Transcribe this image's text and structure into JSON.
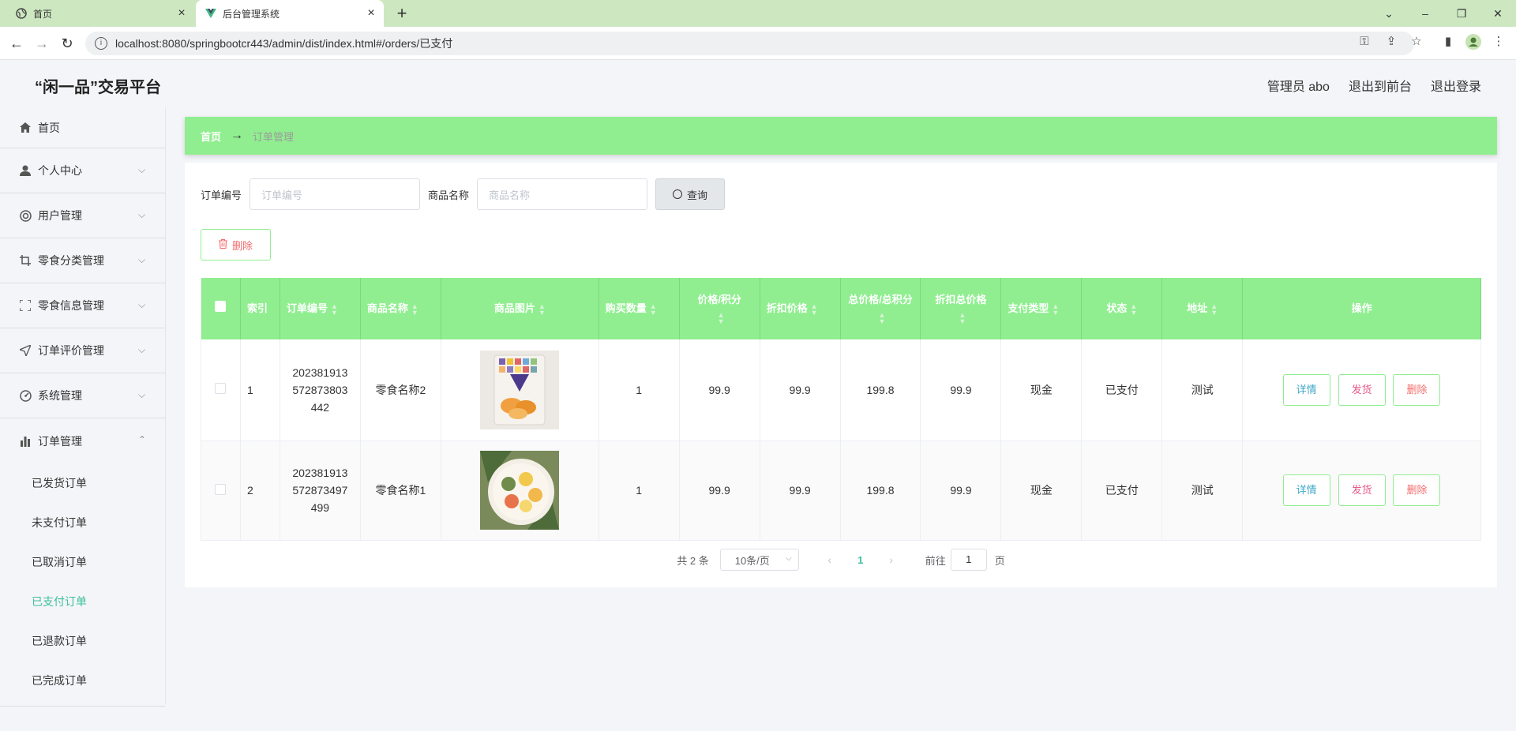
{
  "browser": {
    "tabs": [
      {
        "label": "首页"
      },
      {
        "label": "后台管理系统"
      }
    ],
    "url": "localhost:8080/springbootcr443/admin/dist/index.html#/orders/已支付"
  },
  "header": {
    "logo": "“闲一品”交易平台",
    "user": "管理员 abo",
    "to_front": "退出到前台",
    "logout": "退出登录"
  },
  "sidebar": {
    "items": [
      {
        "label": "首页",
        "icon": "home-icon"
      },
      {
        "label": "个人中心",
        "icon": "user-icon"
      },
      {
        "label": "用户管理",
        "icon": "users-icon"
      },
      {
        "label": "零食分类管理",
        "icon": "crop-icon"
      },
      {
        "label": "零食信息管理",
        "icon": "frame-icon"
      },
      {
        "label": "订单评价管理",
        "icon": "send-icon"
      },
      {
        "label": "系统管理",
        "icon": "gauge-icon"
      },
      {
        "label": "订单管理",
        "icon": "bar-chart-icon"
      }
    ],
    "sub_items": [
      "已发货订单",
      "未支付订单",
      "已取消订单",
      "已支付订单",
      "已退款订单",
      "已完成订单"
    ],
    "active_sub": "已支付订单",
    "active_color": "#3cbfa0"
  },
  "breadcrumb": {
    "home": "首页",
    "current": "订单管理"
  },
  "search": {
    "order_no_label": "订单编号",
    "order_no_placeholder": "订单编号",
    "goods_label": "商品名称",
    "goods_placeholder": "商品名称",
    "query_label": "查询"
  },
  "toolbar": {
    "delete_label": "删除"
  },
  "table": {
    "columns": [
      "索引",
      "订单编号",
      "商品名称",
      "商品图片",
      "购买数量",
      "价格/积分",
      "折扣价格",
      "总价格/总积分",
      "折扣总价格",
      "支付类型",
      "状态",
      "地址",
      "操作"
    ],
    "rows": [
      {
        "index": "1",
        "order_no": [
          "202381913",
          "572873803",
          "442"
        ],
        "goods": "零食名称2",
        "qty": "1",
        "price": "99.9",
        "discount": "99.9",
        "total": "199.8",
        "discount_total": "99.9",
        "pay_type": "现金",
        "status": "已支付",
        "address": "测试"
      },
      {
        "index": "2",
        "order_no": [
          "202381913",
          "572873497",
          "499"
        ],
        "goods": "零食名称1",
        "qty": "1",
        "price": "99.9",
        "discount": "99.9",
        "total": "199.8",
        "discount_total": "99.9",
        "pay_type": "现金",
        "status": "已支付",
        "address": "测试"
      }
    ],
    "actions": {
      "detail": "详情",
      "ship": "发货",
      "delete": "删除"
    }
  },
  "pager": {
    "total": "共 2 条",
    "page_size": "10条/页",
    "current_page": "1",
    "goto_label": "前往",
    "goto_value": "1",
    "page_unit": "页"
  },
  "colors": {
    "header_green": "#90ee90",
    "delete_red": "#f56c6c"
  }
}
